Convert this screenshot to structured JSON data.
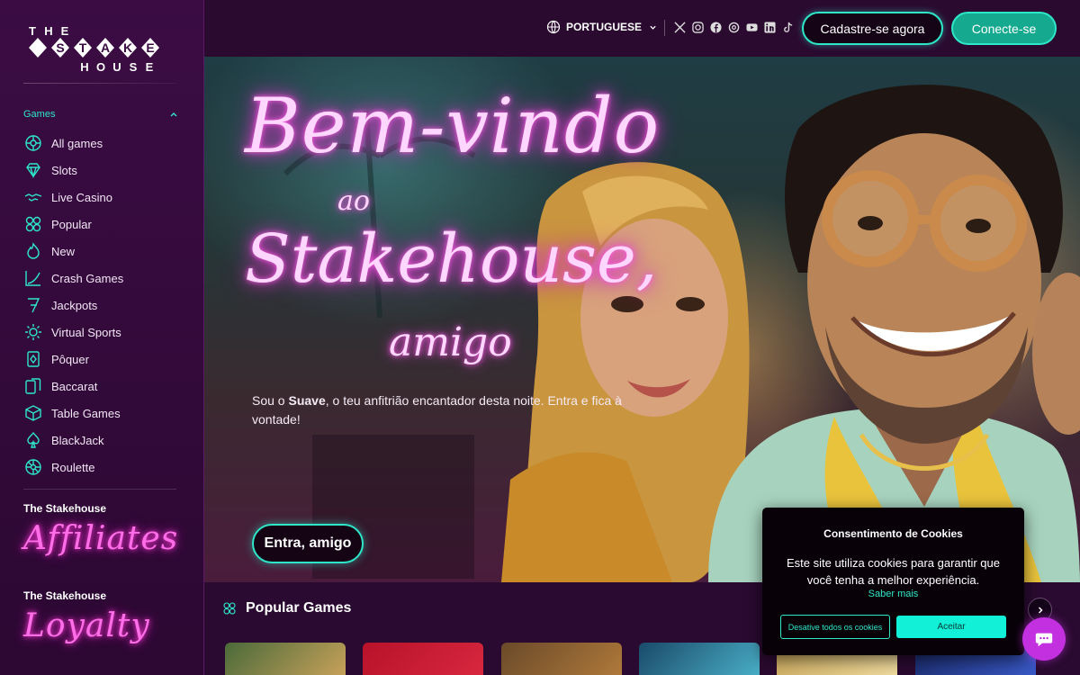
{
  "brand": {
    "logo_letters_top": [
      "T",
      "H",
      "E"
    ],
    "logo_letters_mid": [
      "S",
      "T",
      "A",
      "K",
      "E"
    ],
    "logo_letters_bottom": [
      "H",
      "O",
      "U",
      "S",
      "E"
    ]
  },
  "sidebar": {
    "section_label": "Games",
    "items": [
      {
        "label": "All games",
        "icon": "all-games-icon"
      },
      {
        "label": "Slots",
        "icon": "diamond-icon"
      },
      {
        "label": "Live Casino",
        "icon": "handshake-icon"
      },
      {
        "label": "Popular",
        "icon": "clover-icon"
      },
      {
        "label": "New",
        "icon": "flame-icon"
      },
      {
        "label": "Crash Games",
        "icon": "chart-icon"
      },
      {
        "label": "Jackpots",
        "icon": "seven-icon"
      },
      {
        "label": "Virtual Sports",
        "icon": "gear-icon"
      },
      {
        "label": "Pôquer",
        "icon": "card-icon"
      },
      {
        "label": "Baccarat",
        "icon": "cards-icon"
      },
      {
        "label": "Table Games",
        "icon": "cube-icon"
      },
      {
        "label": "BlackJack",
        "icon": "spade-icon"
      },
      {
        "label": "Roulette",
        "icon": "roulette-icon"
      }
    ],
    "affiliates_title": "The Stakehouse",
    "affiliates_script": "Affiliates",
    "loyalty_title": "The Stakehouse",
    "loyalty_script": "Loyalty"
  },
  "header": {
    "language": "PORTUGUESE",
    "socials": [
      "x-icon",
      "instagram-icon",
      "facebook-icon",
      "threads-icon",
      "youtube-icon",
      "linkedin-icon",
      "tiktok-icon"
    ],
    "register_label": "Cadastre-se agora",
    "login_label": "Conecte-se"
  },
  "hero": {
    "line1": "Bem-vindo",
    "line2": "ao",
    "line3": "Stakehouse,",
    "line4": "amigo",
    "sub_prefix": "Sou o ",
    "sub_bold": "Suave",
    "sub_suffix": ", o teu anfitrião encantador desta noite. Entra e fica à vontade!",
    "cta_label": "Entra, amigo"
  },
  "popular": {
    "title": "Popular Games"
  },
  "cookie": {
    "title": "Consentimento de Cookies",
    "text": "Este site utiliza cookies para garantir que você tenha a melhor experiência.",
    "more_label": "Saber mais",
    "deny_label": "Desative todos os cookies",
    "accept_label": "Aceitar"
  },
  "colors": {
    "accent": "#2ee6c8",
    "neon_pink": "#ff5be6",
    "sidebar_bg": "#3b0c44",
    "chat_button": "#c230e0"
  }
}
